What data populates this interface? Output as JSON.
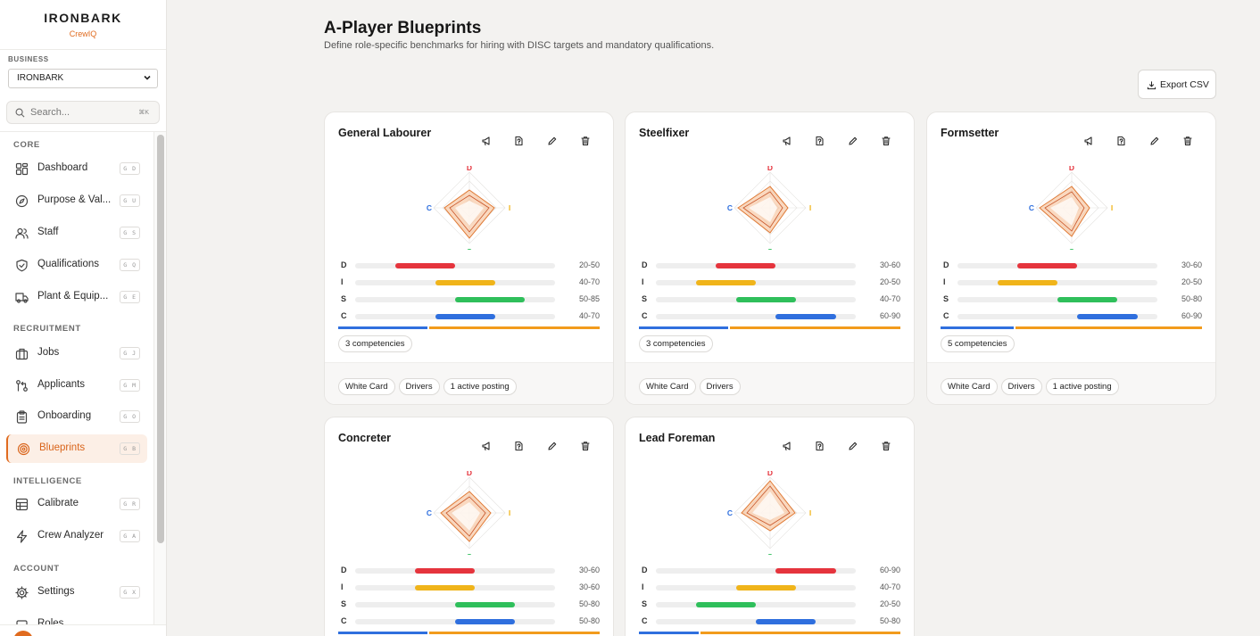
{
  "brand": {
    "name": "IRONBARK",
    "product": "CrewIQ"
  },
  "business": {
    "label": "BUSINESS",
    "selected": "IRONBARK"
  },
  "search": {
    "placeholder": "Search...",
    "shortcut": "⌘K"
  },
  "sidebar": {
    "sections": [
      {
        "title": "CORE",
        "items": [
          {
            "label": "Dashboard",
            "hotkey": "G D",
            "icon": "dashboard-icon"
          },
          {
            "label": "Purpose & Val...",
            "hotkey": "G U",
            "icon": "compass-icon"
          },
          {
            "label": "Staff",
            "hotkey": "G S",
            "icon": "users-icon"
          },
          {
            "label": "Qualifications",
            "hotkey": "G Q",
            "icon": "shield-check-icon"
          },
          {
            "label": "Plant & Equip...",
            "hotkey": "G E",
            "icon": "truck-icon"
          }
        ]
      },
      {
        "title": "RECRUITMENT",
        "items": [
          {
            "label": "Jobs",
            "hotkey": "G J",
            "icon": "briefcase-icon"
          },
          {
            "label": "Applicants",
            "hotkey": "G M",
            "icon": "git-pull-icon"
          },
          {
            "label": "Onboarding",
            "hotkey": "G O",
            "icon": "clipboard-icon"
          },
          {
            "label": "Blueprints",
            "hotkey": "G B",
            "icon": "target-icon",
            "active": true
          }
        ]
      },
      {
        "title": "INTELLIGENCE",
        "items": [
          {
            "label": "Calibrate",
            "hotkey": "G R",
            "icon": "grid-icon"
          },
          {
            "label": "Crew Analyzer",
            "hotkey": "G A",
            "icon": "zap-icon"
          }
        ]
      },
      {
        "title": "ACCOUNT",
        "items": [
          {
            "label": "Settings",
            "hotkey": "G X",
            "icon": "gear-icon"
          },
          {
            "label": "Roles",
            "hotkey": "",
            "icon": "roles-icon"
          }
        ]
      }
    ]
  },
  "page": {
    "title": "A-Player Blueprints",
    "subtitle": "Define role-specific benchmarks for hiring with DISC targets and mandatory qualifications.",
    "export_label": "Export CSV"
  },
  "disc_labels": {
    "d": "D",
    "i": "I",
    "s": "S",
    "c": "C"
  },
  "colors": {
    "d": "#e5343d",
    "i": "#f0b41a",
    "s": "#2fbf5b",
    "c": "#2f6fde",
    "accent": "#e06b1f"
  },
  "blueprints": [
    {
      "name": "General Labourer",
      "disc": {
        "d": [
          20,
          50
        ],
        "i": [
          40,
          70
        ],
        "s": [
          50,
          85
        ],
        "c": [
          40,
          70
        ]
      },
      "ranges": {
        "d": "20-50",
        "i": "40-70",
        "s": "50-85",
        "c": "40-70"
      },
      "split": 0.34,
      "competencies": "3 competencies",
      "tags": [
        "White Card",
        "Drivers",
        "1 active posting"
      ]
    },
    {
      "name": "Steelfixer",
      "disc": {
        "d": [
          30,
          60
        ],
        "i": [
          20,
          50
        ],
        "s": [
          40,
          70
        ],
        "c": [
          60,
          90
        ]
      },
      "ranges": {
        "d": "30-60",
        "i": "20-50",
        "s": "40-70",
        "c": "60-90"
      },
      "split": 0.34,
      "competencies": "3 competencies",
      "tags": [
        "White Card",
        "Drivers"
      ]
    },
    {
      "name": "Formsetter",
      "disc": {
        "d": [
          30,
          60
        ],
        "i": [
          20,
          50
        ],
        "s": [
          50,
          80
        ],
        "c": [
          60,
          90
        ]
      },
      "ranges": {
        "d": "30-60",
        "i": "20-50",
        "s": "50-80",
        "c": "60-90"
      },
      "split": 0.28,
      "competencies": "5 competencies",
      "tags": [
        "White Card",
        "Drivers",
        "1 active posting"
      ]
    },
    {
      "name": "Concreter",
      "disc": {
        "d": [
          30,
          60
        ],
        "i": [
          30,
          60
        ],
        "s": [
          50,
          80
        ],
        "c": [
          50,
          80
        ]
      },
      "ranges": {
        "d": "30-60",
        "i": "30-60",
        "s": "50-80",
        "c": "50-80"
      },
      "split": 0.34
    },
    {
      "name": "Lead Foreman",
      "disc": {
        "d": [
          60,
          90
        ],
        "i": [
          40,
          70
        ],
        "s": [
          20,
          50
        ],
        "c": [
          50,
          80
        ]
      },
      "ranges": {
        "d": "60-90",
        "i": "40-70",
        "s": "20-50",
        "c": "50-80"
      },
      "split": 0.23
    }
  ]
}
